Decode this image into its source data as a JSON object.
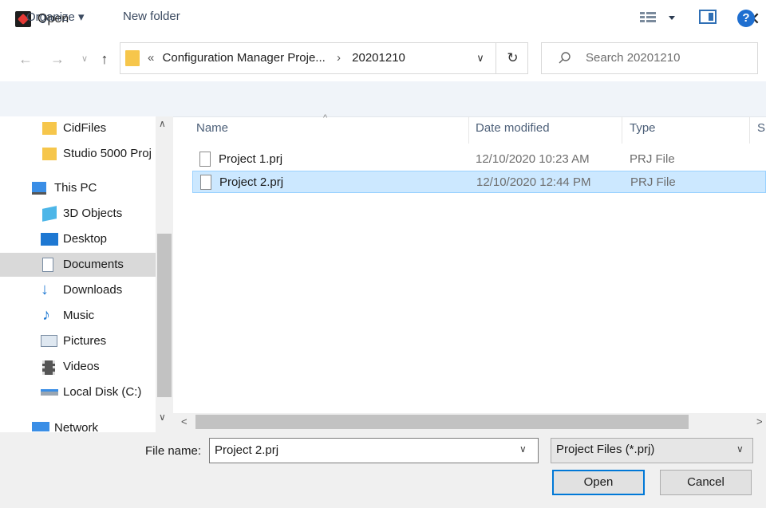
{
  "window": {
    "title": "Open",
    "close_icon": "close-icon"
  },
  "nav": {
    "back_icon": "arrow-left-icon",
    "forward_icon": "arrow-right-icon",
    "recent_icon": "chevron-down-icon",
    "up_icon": "arrow-up-icon"
  },
  "address": {
    "overflow": "«",
    "segment_1": "Configuration Manager Proje...",
    "separator": "›",
    "segment_2": "20201210",
    "dropdown_icon": "chevron-down-icon",
    "refresh_icon": "refresh-icon"
  },
  "search": {
    "placeholder": "Search 20201210"
  },
  "toolbar": {
    "organize_label": "Organize ▾",
    "new_folder_label": "New folder",
    "help_label": "?"
  },
  "sidebar": {
    "items": [
      {
        "label": "CidFiles",
        "icon": "folder-icon"
      },
      {
        "label": "Studio 5000 Proj",
        "icon": "folder-icon"
      },
      {
        "label": "This PC",
        "icon": "computer-icon"
      },
      {
        "label": "3D Objects",
        "icon": "cube-icon"
      },
      {
        "label": "Desktop",
        "icon": "desktop-icon"
      },
      {
        "label": "Documents",
        "icon": "document-icon",
        "selected": true
      },
      {
        "label": "Downloads",
        "icon": "download-icon"
      },
      {
        "label": "Music",
        "icon": "music-note-icon"
      },
      {
        "label": "Pictures",
        "icon": "picture-icon"
      },
      {
        "label": "Videos",
        "icon": "film-icon"
      },
      {
        "label": "Local Disk (C:)",
        "icon": "disk-icon"
      },
      {
        "label": "Network",
        "icon": "network-icon"
      }
    ]
  },
  "columns": {
    "name": "Name",
    "date": "Date modified",
    "type": "Type",
    "size": "Si"
  },
  "files": [
    {
      "name": "Project 1.prj",
      "date": "12/10/2020 10:23 AM",
      "type": "PRJ File"
    },
    {
      "name": "Project 2.prj",
      "date": "12/10/2020 12:44 PM",
      "type": "PRJ File",
      "selected": true
    }
  ],
  "footer": {
    "filename_label": "File name:",
    "filename_value": "Project 2.prj",
    "filetype_value": "Project Files (*.prj)",
    "open_label": "Open",
    "cancel_label": "Cancel"
  },
  "colors": {
    "accent": "#0078d7",
    "selection": "#cce8ff",
    "folder": "#f6c64b"
  }
}
